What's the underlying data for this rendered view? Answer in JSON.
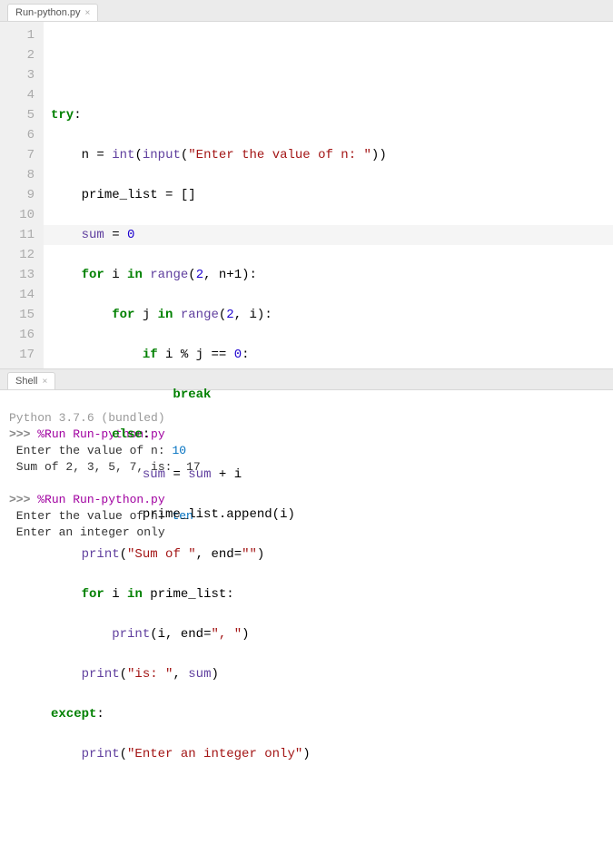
{
  "editor_tab": {
    "label": "Run-python.py"
  },
  "code": {
    "lines": [
      1,
      2,
      3,
      4,
      5,
      6,
      7,
      8,
      9,
      10,
      11,
      12,
      13,
      14,
      15,
      16,
      17
    ],
    "highlight_line": 11,
    "kw_try": "try",
    "colon": ":",
    "id_n": "n",
    "op_eq": "=",
    "fn_int": "int",
    "fn_input": "input",
    "str_prompt": "\"Enter the value of n: \"",
    "id_prime_list": "prime_list",
    "brackets": "[]",
    "id_sum": "sum",
    "num_0": "0",
    "kw_for": "for",
    "id_i": "i",
    "kw_in": "in",
    "fn_range": "range",
    "num_2": "2",
    "id_nplus1": "n+1",
    "id_j": "j",
    "kw_if": "if",
    "op_mod": "%",
    "op_eqeq": "==",
    "kw_break": "break",
    "kw_else": "else",
    "op_plus": "+",
    "id_append": "append",
    "fn_print": "print",
    "str_sumof": "\"Sum of \"",
    "id_end": "end",
    "str_empty": "\"\"",
    "str_comma": "\", \"",
    "str_is": "\"is: \"",
    "kw_except": "except",
    "str_err": "\"Enter an integer only\"",
    "comma": ", ",
    "dot": ".",
    "lparen": "(",
    "rparen": ")"
  },
  "shell_tab": {
    "label": "Shell"
  },
  "shell": {
    "version": "Python 3.7.6 (bundled)",
    "prompt": ">>>",
    "cmd1": "%Run Run-python.py",
    "out1a_label": " Enter the value of n: ",
    "out1a_input": "10",
    "out1b": " Sum of 2, 3, 5, 7, is:  17",
    "cmd2": "%Run Run-python.py",
    "out2a_label": " Enter the value of n: ",
    "out2a_input": "ten",
    "out2b": " Enter an integer only"
  }
}
